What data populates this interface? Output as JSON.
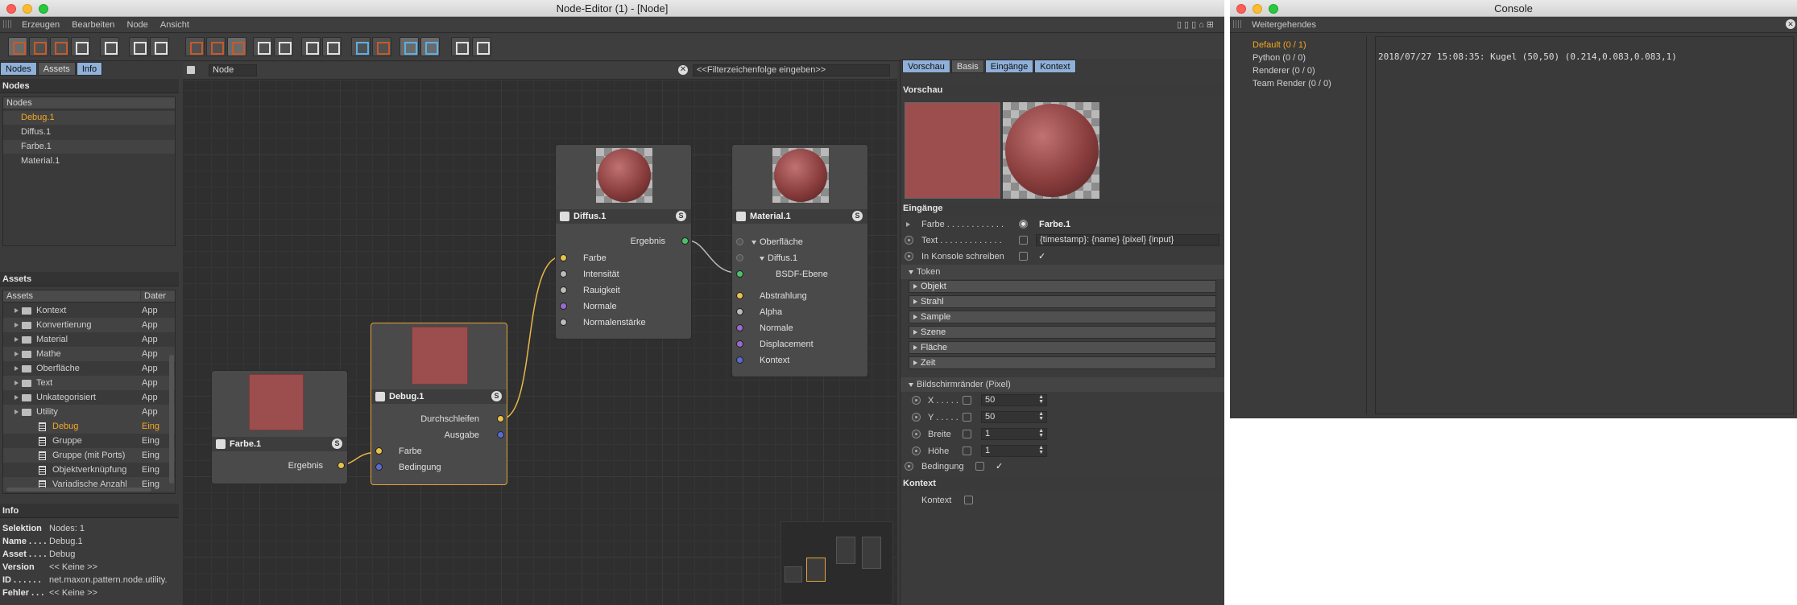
{
  "editor": {
    "title": "Node-Editor (1) - [Node]",
    "menu": [
      "Erzeugen",
      "Bearbeiten",
      "Node",
      "Ansicht"
    ],
    "left_tabs": [
      "Nodes",
      "Assets",
      "Info"
    ],
    "nodes_panel": {
      "header": "Nodes",
      "column": "Nodes",
      "items": [
        "Debug.1",
        "Diffus.1",
        "Farbe.1",
        "Material.1"
      ]
    },
    "assets_panel": {
      "header": "Assets",
      "col1": "Assets",
      "col2": "Dater",
      "items": [
        {
          "label": "Kontext",
          "type": "App"
        },
        {
          "label": "Konvertierung",
          "type": "App"
        },
        {
          "label": "Material",
          "type": "App"
        },
        {
          "label": "Mathe",
          "type": "App"
        },
        {
          "label": "Oberfläche",
          "type": "App"
        },
        {
          "label": "Text",
          "type": "App"
        },
        {
          "label": "Unkategorisiert",
          "type": "App"
        },
        {
          "label": "Utility",
          "type": "App"
        }
      ],
      "subitems": [
        {
          "label": "Debug",
          "type": "Eing"
        },
        {
          "label": "Gruppe",
          "type": "Eing"
        },
        {
          "label": "Gruppe (mit Ports)",
          "type": "Eing"
        },
        {
          "label": "Objektverknüpfung",
          "type": "Eing"
        },
        {
          "label": "Variadische Anzahl",
          "type": "Eing"
        }
      ]
    },
    "info_panel": {
      "header": "Info",
      "rows": [
        {
          "key": "Selektion",
          "value": "Nodes: 1"
        },
        {
          "key": "Name . . . .",
          "value": "Debug.1"
        },
        {
          "key": "Asset . . . .",
          "value": "Debug"
        },
        {
          "key": "Version",
          "value": "<< Keine >>"
        },
        {
          "key": "ID . . . . . .",
          "value": "net.maxon.pattern.node.utility."
        },
        {
          "key": "Fehler . . .",
          "value": "<< Keine >>"
        }
      ]
    },
    "path_label": "Node",
    "filter_placeholder": "<<Filterzeichenfolge eingeben>>",
    "graph": {
      "farbe": {
        "title": "Farbe.1",
        "ports_out": [
          "Ergebnis"
        ]
      },
      "debug": {
        "title": "Debug.1",
        "ports_out": [
          "Durchschleifen",
          "Ausgabe"
        ],
        "ports_in": [
          "Farbe",
          "Bedingung"
        ]
      },
      "diffus": {
        "title": "Diffus.1",
        "ports_out": [
          "Ergebnis"
        ],
        "ports_in": [
          "Farbe",
          "Intensität",
          "Rauigkeit",
          "Normale",
          "Normalenstärke"
        ]
      },
      "material": {
        "title": "Material.1",
        "group": "Oberfläche",
        "sub": "Diffus.1",
        "subport": "BSDF-Ebene",
        "ports_in": [
          "Abstrahlung",
          "Alpha",
          "Normale",
          "Displacement",
          "Kontext"
        ]
      }
    },
    "attr_tabs": [
      "Vorschau",
      "Basis",
      "Eingänge",
      "Kontext"
    ],
    "attr": {
      "vorschau": "Vorschau",
      "eingaenge": "Eingänge",
      "farbe_label": "Farbe . . . . . . . . . . . .",
      "farbe_value": "Farbe.1",
      "text_label": "Text . . . . . . . . . . . . .",
      "text_value": "{timestamp}: {name} {pixel} {input}",
      "konsole_label": "In Konsole schreiben",
      "check": "✓",
      "token": "Token",
      "token_groups": [
        "Objekt",
        "Strahl",
        "Sample",
        "Szene",
        "Fläche",
        "Zeit"
      ],
      "bild": "Bildschirmränder (Pixel)",
      "fields": [
        {
          "label": "X . . . . .",
          "value": "50"
        },
        {
          "label": "Y . . . . .",
          "value": "50"
        },
        {
          "label": "Breite",
          "value": "1"
        },
        {
          "label": "Höhe",
          "value": "1"
        }
      ],
      "bedingung": "Bedingung",
      "kontext_sect": "Kontext",
      "kontext": "Kontext"
    }
  },
  "console": {
    "title": "Console",
    "header": "Weitergehendes",
    "channels": [
      "Default (0 / 1)",
      "Python (0 / 0)",
      "Renderer (0 / 0)",
      "Team Render  (0 / 0)"
    ],
    "output": "2018/07/27 15:08:35: Kugel (50,50) (0.214,0.083,0.083,1)"
  },
  "colors": {
    "accent": "#f5a623",
    "tab_active": "#8fb0d8",
    "port_yellow": "#e8c24a",
    "port_green": "#4fc06a",
    "port_purple": "#9a6ad0",
    "port_blue": "#5a6ad0",
    "port_grey": "#bbbbbb"
  }
}
